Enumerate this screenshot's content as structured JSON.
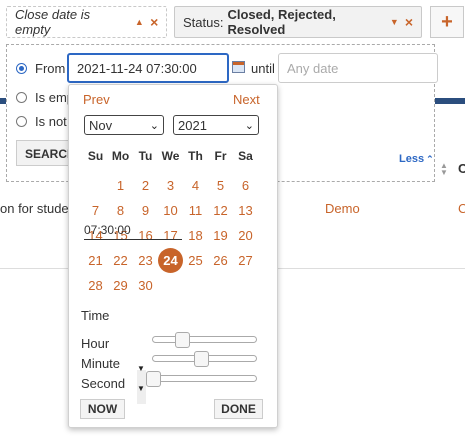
{
  "filters": {
    "close_date_pill": "Close date is empty",
    "status_pill_label": "Status:",
    "status_pill_value": "Closed, Rejected, Resolved",
    "remove_glyph": "×",
    "add_glyph": "+"
  },
  "panel": {
    "from_label": "From",
    "from_value": "2021-11-24 07:30:00",
    "until_label": "until",
    "until_placeholder": "Any date",
    "empty_label": "Is emp",
    "not_label": "Is not",
    "search_button": "SEARCH",
    "less_link": "Less"
  },
  "background_row": {
    "name_text": "on for stude",
    "link_text": "Demo",
    "col_head": "C",
    "col_cell": "C"
  },
  "datepicker": {
    "prev": "Prev",
    "next": "Next",
    "month": "Nov",
    "year": "2021",
    "weekdays": [
      "Su",
      "Mo",
      "Tu",
      "We",
      "Th",
      "Fr",
      "Sa"
    ],
    "weeks": [
      [
        "",
        "1",
        "2",
        "3",
        "4",
        "5",
        "6"
      ],
      [
        "7",
        "8",
        "9",
        "10",
        "11",
        "12",
        "13"
      ],
      [
        "14",
        "15",
        "16",
        "17",
        "18",
        "19",
        "20"
      ],
      [
        "21",
        "22",
        "23",
        "24",
        "25",
        "26",
        "27"
      ],
      [
        "28",
        "29",
        "30",
        "",
        "",
        "",
        ""
      ]
    ],
    "selected_day": "24",
    "time_label": "Time",
    "time_value": "07:30:00",
    "hour_label": "Hour",
    "minute_label": "Minute",
    "second_label": "Second",
    "hour_fraction": 0.3,
    "minute_fraction": 0.5,
    "second_fraction": 0.0,
    "now_button": "NOW",
    "done_button": "DONE"
  },
  "colors": {
    "accent": "#c8642a",
    "focus": "#2d68c4",
    "header_bar": "#2b4e7e"
  }
}
